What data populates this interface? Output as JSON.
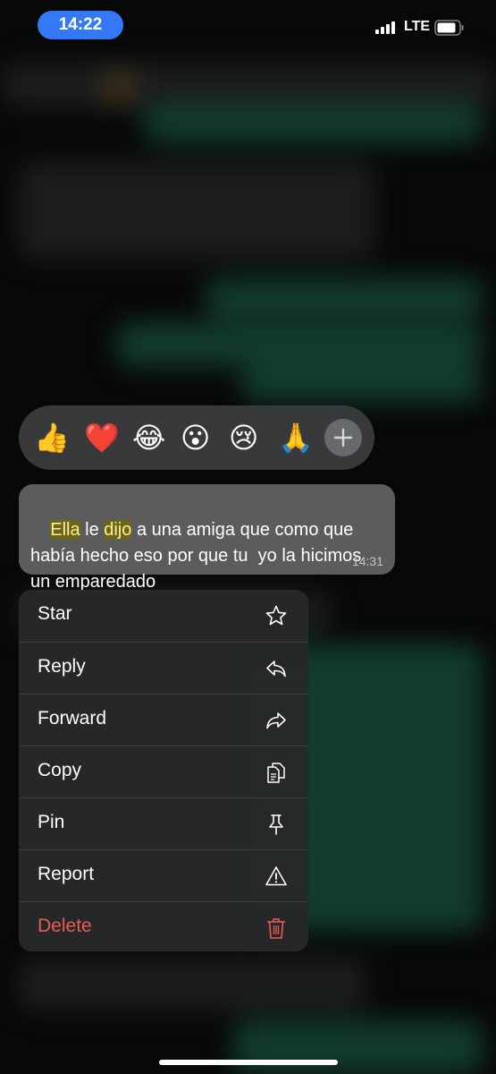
{
  "status_bar": {
    "time": "14:22",
    "network": "LTE"
  },
  "reactions": [
    "👍",
    "❤️",
    "😂",
    "😮",
    "😢",
    "🙏"
  ],
  "message": {
    "words": [
      {
        "t": "Ella",
        "h": true
      },
      {
        "t": " le ",
        "h": false
      },
      {
        "t": "dijo",
        "h": true
      },
      {
        "t": " a una amiga que como que había hecho eso por que tu  yo la hicimos un emparedado",
        "h": false
      }
    ],
    "time": "14:31"
  },
  "menu": [
    {
      "label": "Star",
      "icon": "star-icon"
    },
    {
      "label": "Reply",
      "icon": "reply-icon"
    },
    {
      "label": "Forward",
      "icon": "forward-icon"
    },
    {
      "label": "Copy",
      "icon": "copy-icon"
    },
    {
      "label": "Pin",
      "icon": "pin-icon"
    },
    {
      "label": "Report",
      "icon": "warning-icon"
    },
    {
      "label": "Delete",
      "icon": "trash-icon",
      "danger": true
    }
  ],
  "colors": {
    "highlight": "#ffef8a",
    "danger": "#ec5b53",
    "time_pill": "#3478f6"
  }
}
